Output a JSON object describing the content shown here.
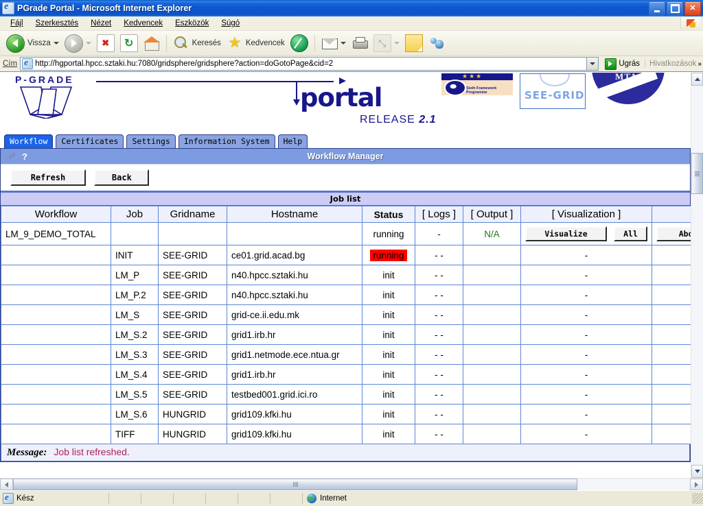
{
  "window": {
    "title": "PGrade Portal - Microsoft Internet Explorer",
    "app_icon": "ie-document-icon",
    "minimize_label": "Minimize",
    "maximize_label": "Restore",
    "close_label": "Close"
  },
  "menubar": {
    "items": [
      {
        "label": "Fájl",
        "name": "menu-file"
      },
      {
        "label": "Szerkesztés",
        "name": "menu-edit"
      },
      {
        "label": "Nézet",
        "name": "menu-view"
      },
      {
        "label": "Kedvencek",
        "name": "menu-favorites"
      },
      {
        "label": "Eszközök",
        "name": "menu-tools"
      },
      {
        "label": "Súgó",
        "name": "menu-help"
      }
    ]
  },
  "toolbar": {
    "back_label": "Vissza",
    "forward_label": "",
    "search_label": "Keresés",
    "favorites_label": "Kedvencek",
    "icons": [
      "back-arrow-icon",
      "forward-arrow-icon",
      "stop-icon",
      "refresh-icon",
      "home-icon",
      "search-icon",
      "favorites-star-icon",
      "history-icon",
      "mail-icon",
      "print-icon",
      "edit-icon",
      "note-icon",
      "messenger-icon"
    ]
  },
  "address_bar": {
    "label": "Cím",
    "url": "http://hgportal.hpcc.sztaki.hu:7080/gridsphere/gridsphere?action=doGotoPage&cid=2",
    "go_label": "Ugrás",
    "links_label": "Hivatkozások",
    "overflow_label": "»"
  },
  "banner": {
    "brand": "P-GRADE",
    "portal_word": "portal",
    "release_prefix": "RELEASE",
    "release_version": "2.1",
    "logos": [
      {
        "name": "eu-sixth-framework-logo",
        "caption": "Sixth Framework Programme"
      },
      {
        "name": "see-grid-logo",
        "caption": "SEE-GRID"
      },
      {
        "name": "mta-sztaki-logo",
        "caption": "MTA"
      }
    ]
  },
  "tabs": [
    {
      "label": "Workflow",
      "name": "tab-workflow",
      "active": true
    },
    {
      "label": "Certificates",
      "name": "tab-certificates",
      "active": false
    },
    {
      "label": "Settings",
      "name": "tab-settings",
      "active": false
    },
    {
      "label": "Information System",
      "name": "tab-information-system",
      "active": false
    },
    {
      "label": "Help",
      "name": "tab-help",
      "active": false
    }
  ],
  "portlet": {
    "title": "Workflow Manager",
    "edit_icon": "pencil-icon",
    "help_icon": "question-mark-icon",
    "buttons": [
      {
        "label": "Refresh",
        "name": "refresh-button"
      },
      {
        "label": "Back",
        "name": "back-button"
      }
    ],
    "section_title": "Job list"
  },
  "table": {
    "headers": [
      "Workflow",
      "Job",
      "Gridname",
      "Hostname",
      "Status",
      "[ Logs ]",
      "[ Output ]",
      "[ Visualization ]",
      ""
    ],
    "rows": [
      {
        "workflow": "LM_9_DEMO_TOTAL",
        "job": "",
        "gridname": "",
        "hostname": "",
        "status": "running",
        "status_highlight": false,
        "logs": "-",
        "output": "N/A",
        "output_style": "na",
        "visualization_buttons": [
          "Visualize",
          "All"
        ],
        "action_button": "Abort"
      },
      {
        "workflow": "",
        "job": "INIT",
        "gridname": "SEE-GRID",
        "hostname": "ce01.grid.acad.bg",
        "status": "running",
        "status_highlight": true,
        "logs": "- -",
        "output": "",
        "visualization": "-"
      },
      {
        "workflow": "",
        "job": "LM_P",
        "gridname": "SEE-GRID",
        "hostname": "n40.hpcc.sztaki.hu",
        "status": "init",
        "status_highlight": false,
        "logs": "- -",
        "output": "",
        "visualization": "-"
      },
      {
        "workflow": "",
        "job": "LM_P.2",
        "gridname": "SEE-GRID",
        "hostname": "n40.hpcc.sztaki.hu",
        "status": "init",
        "status_highlight": false,
        "logs": "- -",
        "output": "",
        "visualization": "-"
      },
      {
        "workflow": "",
        "job": "LM_S",
        "gridname": "SEE-GRID",
        "hostname": "grid-ce.ii.edu.mk",
        "status": "init",
        "status_highlight": false,
        "logs": "- -",
        "output": "",
        "visualization": "-"
      },
      {
        "workflow": "",
        "job": "LM_S.2",
        "gridname": "SEE-GRID",
        "hostname": "grid1.irb.hr",
        "status": "init",
        "status_highlight": false,
        "logs": "- -",
        "output": "",
        "visualization": "-"
      },
      {
        "workflow": "",
        "job": "LM_S.3",
        "gridname": "SEE-GRID",
        "hostname": "grid1.netmode.ece.ntua.gr",
        "status": "init",
        "status_highlight": false,
        "logs": "- -",
        "output": "",
        "visualization": "-"
      },
      {
        "workflow": "",
        "job": "LM_S.4",
        "gridname": "SEE-GRID",
        "hostname": "grid1.irb.hr",
        "status": "init",
        "status_highlight": false,
        "logs": "- -",
        "output": "",
        "visualization": "-"
      },
      {
        "workflow": "",
        "job": "LM_S.5",
        "gridname": "SEE-GRID",
        "hostname": "testbed001.grid.ici.ro",
        "status": "init",
        "status_highlight": false,
        "logs": "- -",
        "output": "",
        "visualization": "-"
      },
      {
        "workflow": "",
        "job": "LM_S.6",
        "gridname": "HUNGRID",
        "hostname": "grid109.kfki.hu",
        "status": "init",
        "status_highlight": false,
        "logs": "- -",
        "output": "",
        "visualization": "-"
      },
      {
        "workflow": "",
        "job": "TIFF",
        "gridname": "HUNGRID",
        "hostname": "grid109.kfki.hu",
        "status": "init",
        "status_highlight": false,
        "logs": "- -",
        "output": "",
        "visualization": "-"
      }
    ]
  },
  "message": {
    "label": "Message:",
    "text": "Job list refreshed."
  },
  "statusbar": {
    "status": "Kész",
    "zone": "Internet",
    "zone_icon": "globe-icon"
  },
  "colors": {
    "titlebar_blue": "#0c53c9",
    "portlet_header": "#7d9be0",
    "tab_active": "#1a64e8",
    "tab_inactive": "#8aa4e2",
    "joblist_header": "#ccccf5",
    "table_border": "#5b86d6",
    "running_red": "#ff0000",
    "na_green": "#1c7a1c",
    "message_pink": "#b0225c",
    "brand_navy": "#17178c"
  }
}
